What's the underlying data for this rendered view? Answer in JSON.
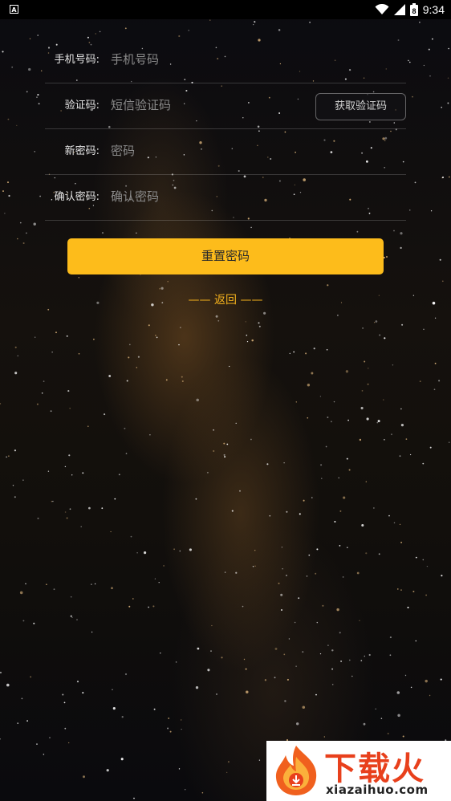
{
  "status_bar": {
    "indicator": "A",
    "time": "9:34",
    "battery_digit": "8",
    "icons": [
      "wifi-icon",
      "signal-icon",
      "battery-icon"
    ]
  },
  "form": {
    "phone": {
      "label": "手机号码:",
      "placeholder": "手机号码",
      "value": ""
    },
    "code": {
      "label": "验证码:",
      "placeholder": "短信验证码",
      "value": "",
      "button_label": "获取验证码"
    },
    "new_password": {
      "label": "新密码:",
      "placeholder": "密码",
      "value": ""
    },
    "confirm_password": {
      "label": "确认密码:",
      "placeholder": "确认密码",
      "value": ""
    }
  },
  "actions": {
    "reset_label": "重置密码",
    "back_label": "—— 返回 ——"
  },
  "watermark": {
    "title": "下载火",
    "url": "xiazaihuo.com"
  },
  "colors": {
    "accent": "#fdbc1b",
    "back_link": "#f5b21c",
    "watermark_red": "#e8401c"
  }
}
